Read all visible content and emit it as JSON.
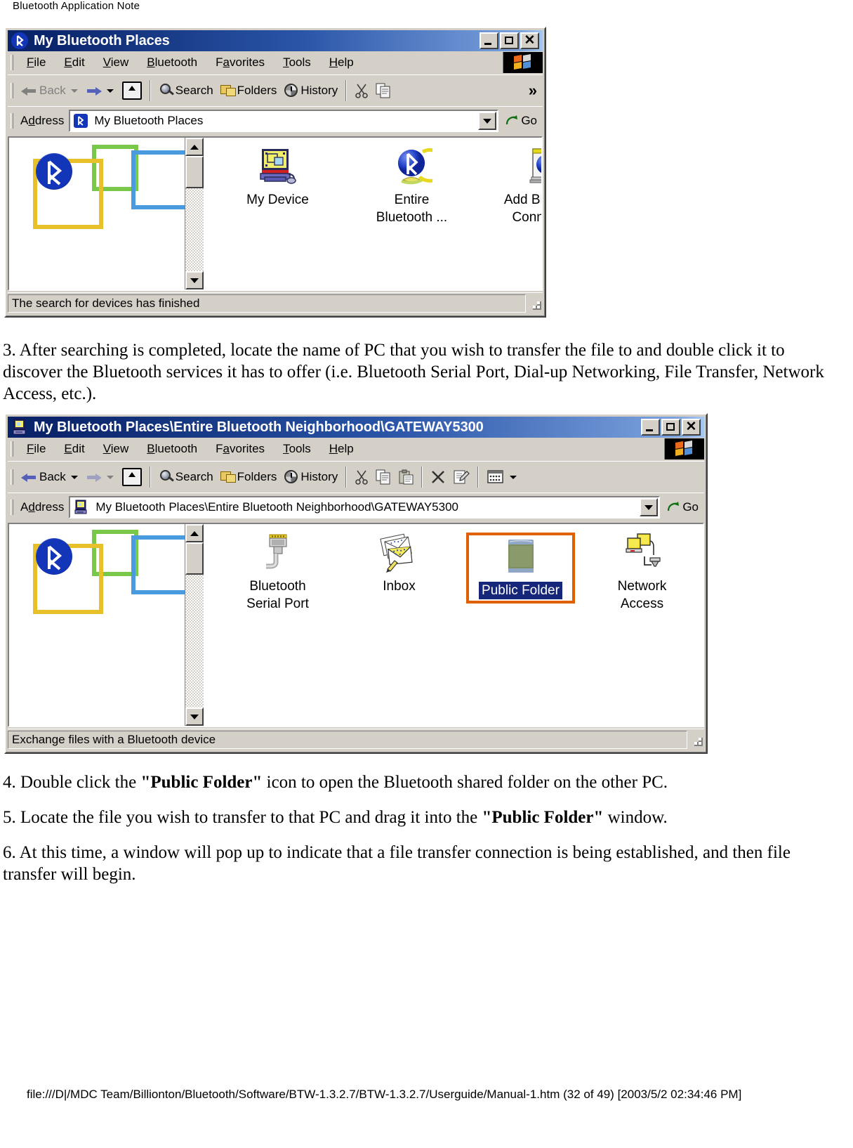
{
  "page": {
    "header": "Bluetooth Application Note",
    "footer": "file:///D|/MDC Team/Billionton/Bluetooth/Software/BTW-1.3.2.7/BTW-1.3.2.7/Userguide/Manual-1.htm (32 of 49) [2003/5/2 02:34:46 PM]"
  },
  "window1": {
    "title": "My Bluetooth Places",
    "title_icon": "bluetooth-icon",
    "buttons": {
      "minimize": "_",
      "maximize": "□",
      "close": "✕"
    },
    "menu": [
      "File",
      "Edit",
      "View",
      "Bluetooth",
      "Favorites",
      "Tools",
      "Help"
    ],
    "toolbar": {
      "back": "Back",
      "forward": "",
      "up": "",
      "search": "Search",
      "folders": "Folders",
      "history": "History",
      "overflow": "»"
    },
    "address": {
      "label": "Address",
      "value": "My Bluetooth Places",
      "icon": "bluetooth-icon",
      "go": "Go"
    },
    "items": [
      {
        "name": "My Device",
        "line2": "",
        "icon": "my-device-icon",
        "selected": false
      },
      {
        "name": "Entire",
        "line2": "Bluetooth ...",
        "icon": "bluetooth-globe-icon",
        "selected": false
      },
      {
        "name": "Add Bluetooth",
        "line2": "Connection",
        "icon": "add-bluetooth-connection-icon",
        "selected": false
      }
    ],
    "status": "The search for devices has finished"
  },
  "para1": "3. After searching is completed, locate the name of PC that you wish to transfer the file to and double click it to discover the Bluetooth services it has to offer (i.e. Bluetooth Serial Port, Dial-up Networking, File Transfer, Network Access, etc.).",
  "window2": {
    "title": "My Bluetooth Places\\Entire Bluetooth Neighborhood\\GATEWAY5300",
    "title_icon": "computer-icon",
    "buttons": {
      "minimize": "_",
      "maximize": "□",
      "close": "✕"
    },
    "menu": [
      "File",
      "Edit",
      "View",
      "Bluetooth",
      "Favorites",
      "Tools",
      "Help"
    ],
    "toolbar": {
      "back": "Back",
      "forward": "",
      "up": "",
      "search": "Search",
      "folders": "Folders",
      "history": "History",
      "cut": "",
      "copy": "",
      "paste": "",
      "delete": "",
      "properties": "",
      "views": ""
    },
    "address": {
      "label": "Address",
      "value": "My Bluetooth Places\\Entire Bluetooth Neighborhood\\GATEWAY5300",
      "icon": "computer-icon",
      "go": "Go"
    },
    "items": [
      {
        "name": "Bluetooth",
        "line2": "Serial Port",
        "icon": "serial-port-icon",
        "selected": false
      },
      {
        "name": "Inbox",
        "line2": "",
        "icon": "inbox-icon",
        "selected": false
      },
      {
        "name": "Public Folder",
        "line2": "",
        "icon": "folder-icon",
        "selected": true
      },
      {
        "name": "Network",
        "line2": "Access",
        "icon": "network-access-icon",
        "selected": false
      }
    ],
    "status": "Exchange files with a Bluetooth device"
  },
  "para4_pre": "4. Double click the ",
  "para4_bold": "\"Public Folder\"",
  "para4_post": " icon to open the Bluetooth shared folder on the other PC.",
  "para5_pre": "5. Locate the file you wish to transfer to that PC and drag it into the ",
  "para5_bold": "\"Public Folder\"",
  "para5_post": " window.",
  "para6": "6. At this time, a window will pop up to indicate that a file transfer connection is being established, and then file transfer will begin.",
  "colors": {
    "title_bar_start": "#0a246a",
    "title_bar_end": "#a6c8f0",
    "face": "#d4d0c8",
    "selection_border": "#e06000",
    "selection_bg": "#16277a",
    "bluetooth_blue": "#1336b8"
  }
}
